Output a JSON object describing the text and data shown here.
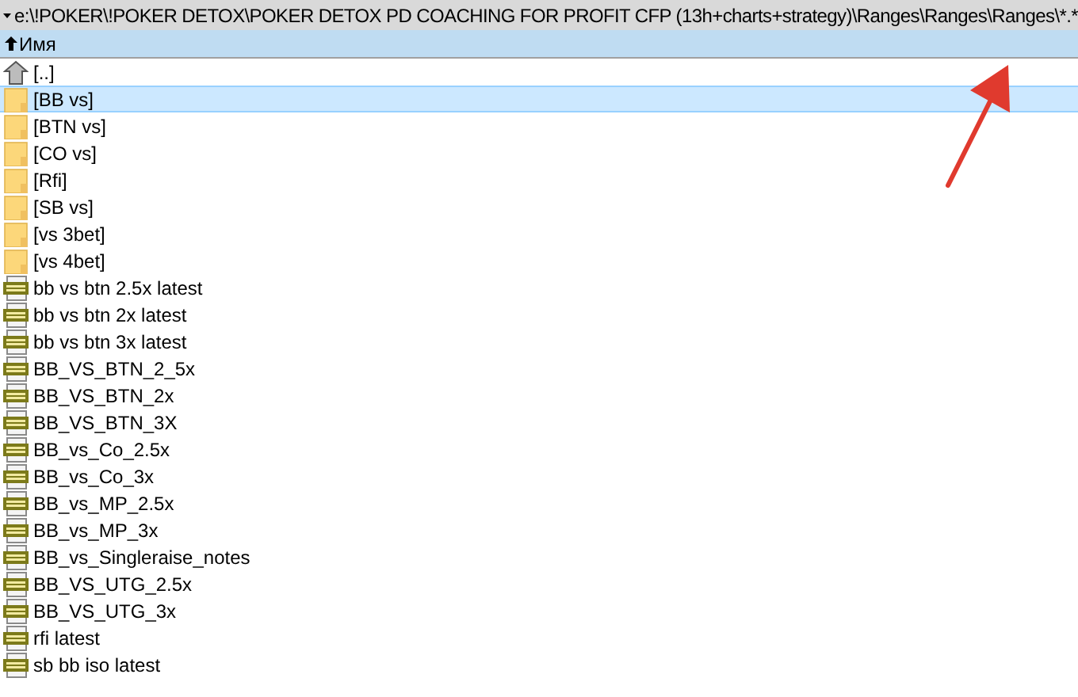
{
  "path_bar": {
    "expanded": true,
    "path": "e:\\!POKER\\!POKER DETOX\\POKER DETOX PD COACHING FOR PROFIT CFP (13h+charts+strategy)\\Ranges\\Ranges\\Ranges\\*.*"
  },
  "columns": [
    {
      "label": "Имя",
      "sorted_ascending": true
    }
  ],
  "files": [
    {
      "kind": "up",
      "name": "[..]",
      "selected": false
    },
    {
      "kind": "folder",
      "name": "[BB vs]",
      "selected": true
    },
    {
      "kind": "folder",
      "name": "[BTN vs]",
      "selected": false
    },
    {
      "kind": "folder",
      "name": "[CO vs]",
      "selected": false
    },
    {
      "kind": "folder",
      "name": "[Rfi]",
      "selected": false
    },
    {
      "kind": "folder",
      "name": "[SB vs]",
      "selected": false
    },
    {
      "kind": "folder",
      "name": "[vs 3bet]",
      "selected": false
    },
    {
      "kind": "folder",
      "name": "[vs 4bet]",
      "selected": false
    },
    {
      "kind": "jpg",
      "name": "bb vs btn 2.5x latest",
      "selected": false
    },
    {
      "kind": "jpg",
      "name": "bb vs btn 2x latest",
      "selected": false
    },
    {
      "kind": "jpg",
      "name": "bb vs btn 3x latest",
      "selected": false
    },
    {
      "kind": "jpg",
      "name": "BB_VS_BTN_2_5x",
      "selected": false
    },
    {
      "kind": "jpg",
      "name": "BB_VS_BTN_2x",
      "selected": false
    },
    {
      "kind": "jpg",
      "name": "BB_VS_BTN_3X",
      "selected": false
    },
    {
      "kind": "jpg",
      "name": "BB_vs_Co_2.5x",
      "selected": false
    },
    {
      "kind": "jpg",
      "name": "BB_vs_Co_3x",
      "selected": false
    },
    {
      "kind": "jpg",
      "name": "BB_vs_MP_2.5x",
      "selected": false
    },
    {
      "kind": "jpg",
      "name": "BB_vs_MP_3x",
      "selected": false
    },
    {
      "kind": "jpg",
      "name": "BB_vs_Singleraise_notes",
      "selected": false
    },
    {
      "kind": "jpg",
      "name": "BB_VS_UTG_2.5x",
      "selected": false
    },
    {
      "kind": "jpg",
      "name": "BB_VS_UTG_3x",
      "selected": false
    },
    {
      "kind": "jpg",
      "name": "rfi latest",
      "selected": false
    },
    {
      "kind": "jpg",
      "name": "sb bb iso latest",
      "selected": false
    }
  ]
}
